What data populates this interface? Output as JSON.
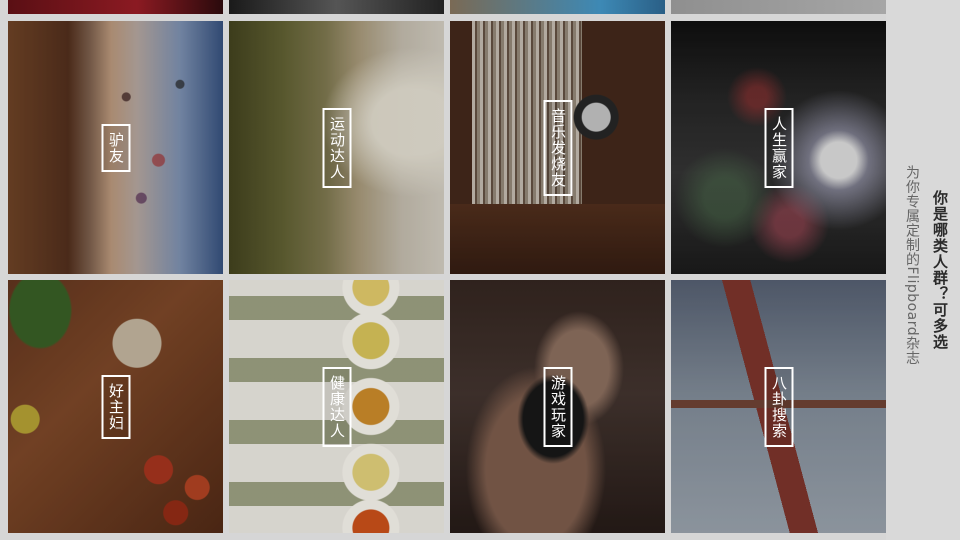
{
  "heading": {
    "title": "你是哪类人群？可多选",
    "subtitle": "为你专属定制的Flipboard杂志"
  },
  "tiles": [
    {
      "label": "驴友"
    },
    {
      "label": "运动达人"
    },
    {
      "label": "音乐发烧友"
    },
    {
      "label": "人生赢家"
    },
    {
      "label": "好主妇"
    },
    {
      "label": "健康达人"
    },
    {
      "label": "游戏玩家"
    },
    {
      "label": "八卦搜索"
    }
  ]
}
